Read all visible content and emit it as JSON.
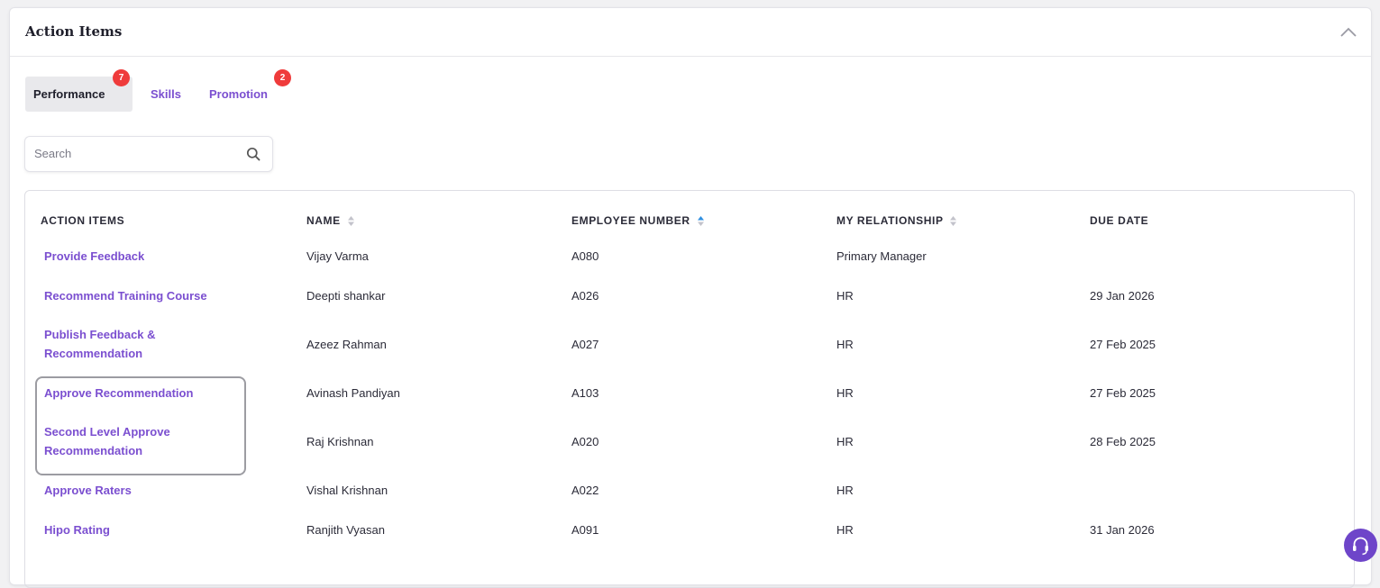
{
  "card": {
    "title": "Action Items"
  },
  "tabs": [
    {
      "label": "Performance",
      "badge": "7",
      "active": true
    },
    {
      "label": "Skills",
      "badge": "",
      "active": false
    },
    {
      "label": "Promotion",
      "badge": "2",
      "active": false
    }
  ],
  "search": {
    "placeholder": "Search",
    "value": ""
  },
  "table": {
    "headers": [
      "ACTION ITEMS",
      "NAME",
      "EMPLOYEE NUMBER",
      "MY RELATIONSHIP",
      "DUE DATE"
    ],
    "rows": [
      {
        "action": "Provide Feedback",
        "name": "Vijay Varma",
        "emp": "A080",
        "rel": "Primary Manager",
        "due": ""
      },
      {
        "action": "Recommend Training Course",
        "name": "Deepti shankar",
        "emp": "A026",
        "rel": "HR",
        "due": "29 Jan 2026"
      },
      {
        "action": "Publish Feedback & Recommendation",
        "name": "Azeez Rahman",
        "emp": "A027",
        "rel": "HR",
        "due": "27 Feb 2025"
      },
      {
        "action": "Approve Recommendation",
        "name": "Avinash Pandiyan",
        "emp": "A103",
        "rel": "HR",
        "due": "27 Feb 2025"
      },
      {
        "action": "Second Level Approve Recommendation",
        "name": "Raj Krishnan",
        "emp": "A020",
        "rel": "HR",
        "due": "28 Feb 2025"
      },
      {
        "action": "Approve Raters",
        "name": "Vishal Krishnan",
        "emp": "A022",
        "rel": "HR",
        "due": ""
      },
      {
        "action": "Hipo Rating",
        "name": "Ranjith Vyasan",
        "emp": "A091",
        "rel": "HR",
        "due": "31 Jan 2026"
      }
    ]
  },
  "colors": {
    "accent": "#7b4fd0",
    "badge": "#ef3b3b",
    "help": "#6e45c9"
  },
  "icons": {
    "search": "search-icon",
    "collapse": "chevron-up-icon",
    "help": "headset-icon",
    "sort": "sort-icon"
  }
}
